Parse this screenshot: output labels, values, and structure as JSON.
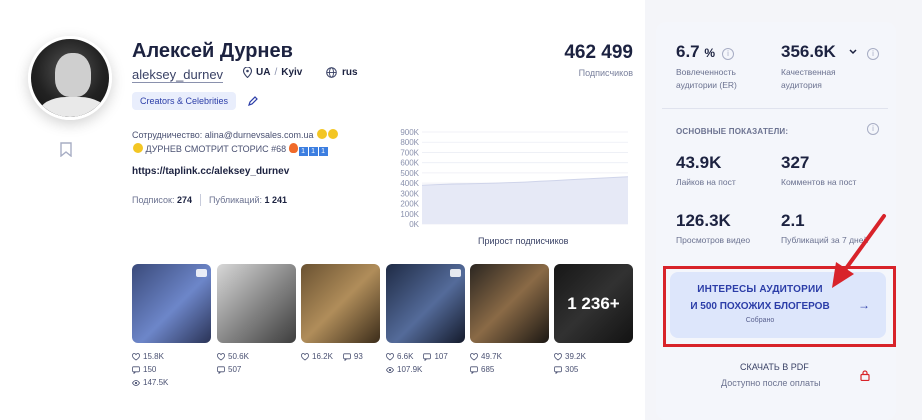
{
  "profile": {
    "name": "Алексей Дурнев",
    "handle": "aleksey_durnev",
    "country": "UA",
    "city": "Kyiv",
    "language": "rus",
    "category": "Creators & Celebrities",
    "subscribers": "462 499",
    "subscribers_label": "Подписчиков",
    "bio_line1": "Сотрудничество: alina@durnevsales.com.ua",
    "bio_line2": "ДУРНЕВ СМОТРИТ СТОРИС #68",
    "link": "https://taplink.cc/aleksey_durnev",
    "following_label": "Подписок:",
    "following": "274",
    "posts_label": "Публикаций:",
    "posts": "1 241"
  },
  "chart_data": {
    "type": "area",
    "title": "Прирост подписчиков",
    "y_ticks": [
      "900K",
      "800K",
      "700K",
      "600K",
      "500K",
      "400K",
      "300K",
      "200K",
      "100K",
      "0K"
    ],
    "ylim": [
      0,
      900000
    ],
    "series": [
      {
        "values": [
          380000,
          385000,
          390000,
          392000,
          396000,
          400000,
          405000,
          410000,
          418000,
          425000,
          432000,
          440000,
          448000,
          455000,
          462499
        ]
      }
    ],
    "grid": true
  },
  "posts": [
    {
      "likes": "15.8K",
      "comments": "150",
      "views": "147.5K",
      "video": true
    },
    {
      "likes": "50.6K",
      "comments": "507"
    },
    {
      "likes": "16.2K",
      "comments": "93"
    },
    {
      "likes": "6.6K",
      "comments": "107",
      "views": "107.9K",
      "video": true
    },
    {
      "likes": "49.7K",
      "comments": "685"
    },
    {
      "likes": "39.2K",
      "comments": "305",
      "more": "1 236+"
    }
  ],
  "metrics": {
    "er_value": "6.7",
    "er_unit": "%",
    "er_label1": "Вовлеченность",
    "er_label2": "аудитории (ER)",
    "qa_value": "356.6K",
    "qa_label1": "Качественная",
    "qa_label2": "аудитория",
    "section_title": "ОСНОВНЫЕ ПОКАЗАТЕЛИ:",
    "likes_value": "43.9K",
    "likes_label": "Лайков на пост",
    "comments_value": "327",
    "comments_label": "Комментов на пост",
    "video_value": "126.3K",
    "video_label": "Просмотров видео",
    "pubs_value": "2.1",
    "pubs_label": "Публикаций за 7 дней"
  },
  "cta": {
    "line1": "ИНТЕРЕСЫ АУДИТОРИИ",
    "line2": "И 500 ПОХОЖИХ БЛОГЕРОВ",
    "line3": "Собрано",
    "arrow": "→"
  },
  "pdf": {
    "label": "СКАЧАТЬ В PDF",
    "sub": "Доступно после оплаты"
  },
  "colors": {
    "accent": "#2c3ea8",
    "highlight": "#d8232a",
    "panel": "#f4f6fb"
  }
}
